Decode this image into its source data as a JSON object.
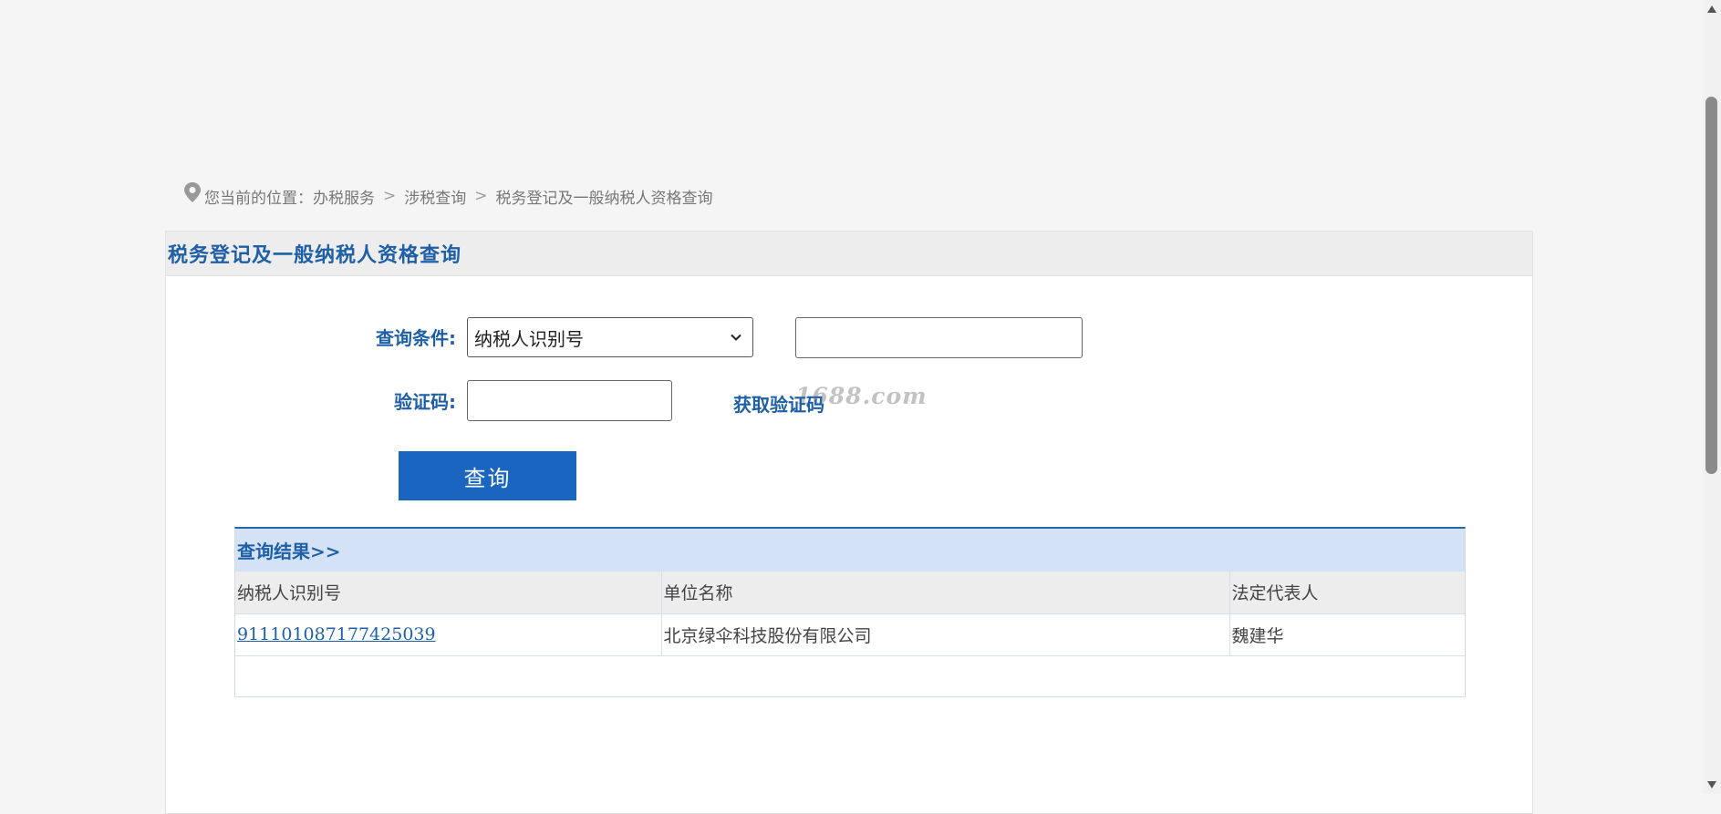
{
  "breadcrumb": {
    "prefix": "您当前的位置：",
    "items": [
      "办税服务",
      "涉税查询",
      "税务登记及一般纳税人资格查询"
    ],
    "separator": ">"
  },
  "panel": {
    "title": "税务登记及一般纳税人资格查询"
  },
  "form": {
    "condition_label": "查询条件:",
    "condition_selected": "纳税人识别号",
    "condition_value": "",
    "captcha_label": "验证码:",
    "captcha_value": "",
    "get_code_label": "获取验证码",
    "watermark_text": "1688.com",
    "submit_label": "查询"
  },
  "results": {
    "title": "查询结果>>",
    "columns": [
      "纳税人识别号",
      "单位名称",
      "法定代表人"
    ],
    "rows": [
      [
        "911101087177425039",
        "北京绿伞科技股份有限公司",
        "魏建华"
      ]
    ]
  },
  "colors": {
    "accent": "#1f5fa6",
    "button": "#1a65c0",
    "results_header": "#d3e3f5"
  }
}
